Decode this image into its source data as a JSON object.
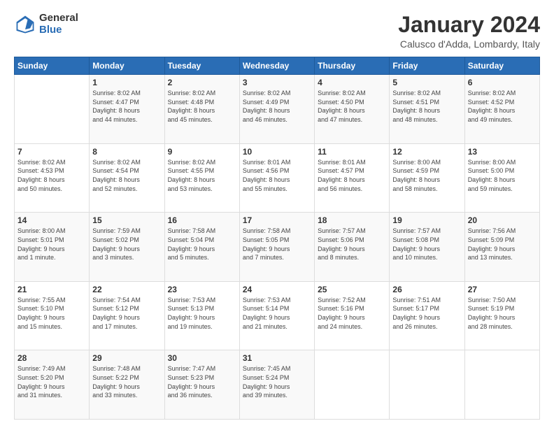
{
  "logo": {
    "general": "General",
    "blue": "Blue"
  },
  "header": {
    "title": "January 2024",
    "subtitle": "Calusco d'Adda, Lombardy, Italy"
  },
  "days_of_week": [
    "Sunday",
    "Monday",
    "Tuesday",
    "Wednesday",
    "Thursday",
    "Friday",
    "Saturday"
  ],
  "weeks": [
    [
      {
        "day": "",
        "info": ""
      },
      {
        "day": "1",
        "info": "Sunrise: 8:02 AM\nSunset: 4:47 PM\nDaylight: 8 hours\nand 44 minutes."
      },
      {
        "day": "2",
        "info": "Sunrise: 8:02 AM\nSunset: 4:48 PM\nDaylight: 8 hours\nand 45 minutes."
      },
      {
        "day": "3",
        "info": "Sunrise: 8:02 AM\nSunset: 4:49 PM\nDaylight: 8 hours\nand 46 minutes."
      },
      {
        "day": "4",
        "info": "Sunrise: 8:02 AM\nSunset: 4:50 PM\nDaylight: 8 hours\nand 47 minutes."
      },
      {
        "day": "5",
        "info": "Sunrise: 8:02 AM\nSunset: 4:51 PM\nDaylight: 8 hours\nand 48 minutes."
      },
      {
        "day": "6",
        "info": "Sunrise: 8:02 AM\nSunset: 4:52 PM\nDaylight: 8 hours\nand 49 minutes."
      }
    ],
    [
      {
        "day": "7",
        "info": "Sunrise: 8:02 AM\nSunset: 4:53 PM\nDaylight: 8 hours\nand 50 minutes."
      },
      {
        "day": "8",
        "info": "Sunrise: 8:02 AM\nSunset: 4:54 PM\nDaylight: 8 hours\nand 52 minutes."
      },
      {
        "day": "9",
        "info": "Sunrise: 8:02 AM\nSunset: 4:55 PM\nDaylight: 8 hours\nand 53 minutes."
      },
      {
        "day": "10",
        "info": "Sunrise: 8:01 AM\nSunset: 4:56 PM\nDaylight: 8 hours\nand 55 minutes."
      },
      {
        "day": "11",
        "info": "Sunrise: 8:01 AM\nSunset: 4:57 PM\nDaylight: 8 hours\nand 56 minutes."
      },
      {
        "day": "12",
        "info": "Sunrise: 8:00 AM\nSunset: 4:59 PM\nDaylight: 8 hours\nand 58 minutes."
      },
      {
        "day": "13",
        "info": "Sunrise: 8:00 AM\nSunset: 5:00 PM\nDaylight: 8 hours\nand 59 minutes."
      }
    ],
    [
      {
        "day": "14",
        "info": "Sunrise: 8:00 AM\nSunset: 5:01 PM\nDaylight: 9 hours\nand 1 minute."
      },
      {
        "day": "15",
        "info": "Sunrise: 7:59 AM\nSunset: 5:02 PM\nDaylight: 9 hours\nand 3 minutes."
      },
      {
        "day": "16",
        "info": "Sunrise: 7:58 AM\nSunset: 5:04 PM\nDaylight: 9 hours\nand 5 minutes."
      },
      {
        "day": "17",
        "info": "Sunrise: 7:58 AM\nSunset: 5:05 PM\nDaylight: 9 hours\nand 7 minutes."
      },
      {
        "day": "18",
        "info": "Sunrise: 7:57 AM\nSunset: 5:06 PM\nDaylight: 9 hours\nand 8 minutes."
      },
      {
        "day": "19",
        "info": "Sunrise: 7:57 AM\nSunset: 5:08 PM\nDaylight: 9 hours\nand 10 minutes."
      },
      {
        "day": "20",
        "info": "Sunrise: 7:56 AM\nSunset: 5:09 PM\nDaylight: 9 hours\nand 13 minutes."
      }
    ],
    [
      {
        "day": "21",
        "info": "Sunrise: 7:55 AM\nSunset: 5:10 PM\nDaylight: 9 hours\nand 15 minutes."
      },
      {
        "day": "22",
        "info": "Sunrise: 7:54 AM\nSunset: 5:12 PM\nDaylight: 9 hours\nand 17 minutes."
      },
      {
        "day": "23",
        "info": "Sunrise: 7:53 AM\nSunset: 5:13 PM\nDaylight: 9 hours\nand 19 minutes."
      },
      {
        "day": "24",
        "info": "Sunrise: 7:53 AM\nSunset: 5:14 PM\nDaylight: 9 hours\nand 21 minutes."
      },
      {
        "day": "25",
        "info": "Sunrise: 7:52 AM\nSunset: 5:16 PM\nDaylight: 9 hours\nand 24 minutes."
      },
      {
        "day": "26",
        "info": "Sunrise: 7:51 AM\nSunset: 5:17 PM\nDaylight: 9 hours\nand 26 minutes."
      },
      {
        "day": "27",
        "info": "Sunrise: 7:50 AM\nSunset: 5:19 PM\nDaylight: 9 hours\nand 28 minutes."
      }
    ],
    [
      {
        "day": "28",
        "info": "Sunrise: 7:49 AM\nSunset: 5:20 PM\nDaylight: 9 hours\nand 31 minutes."
      },
      {
        "day": "29",
        "info": "Sunrise: 7:48 AM\nSunset: 5:22 PM\nDaylight: 9 hours\nand 33 minutes."
      },
      {
        "day": "30",
        "info": "Sunrise: 7:47 AM\nSunset: 5:23 PM\nDaylight: 9 hours\nand 36 minutes."
      },
      {
        "day": "31",
        "info": "Sunrise: 7:45 AM\nSunset: 5:24 PM\nDaylight: 9 hours\nand 39 minutes."
      },
      {
        "day": "",
        "info": ""
      },
      {
        "day": "",
        "info": ""
      },
      {
        "day": "",
        "info": ""
      }
    ]
  ]
}
